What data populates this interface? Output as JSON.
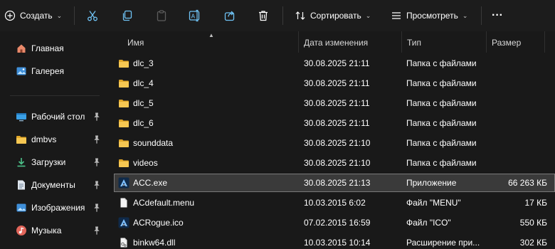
{
  "toolbar": {
    "create_label": "Создать",
    "sort_label": "Сортировать",
    "view_label": "Просмотреть",
    "more_label": "···"
  },
  "nav": {
    "items": [
      {
        "label": "Главная",
        "icon": "home-icon"
      },
      {
        "label": "Галерея",
        "icon": "gallery-icon"
      },
      {
        "label": "Рабочий стол",
        "icon": "desktop-icon"
      },
      {
        "label": "dmbvs",
        "icon": "folder-icon"
      },
      {
        "label": "Загрузки",
        "icon": "download-icon"
      },
      {
        "label": "Документы",
        "icon": "documents-icon"
      },
      {
        "label": "Изображения",
        "icon": "pictures-icon"
      },
      {
        "label": "Музыка",
        "icon": "music-icon"
      }
    ]
  },
  "columns": {
    "name": "Имя",
    "date": "Дата изменения",
    "type": "Тип",
    "size": "Размер"
  },
  "files": [
    {
      "name": "dlc_3",
      "date": "30.08.2025 21:11",
      "type": "Папка с файлами",
      "size": "",
      "icon": "folder-icon"
    },
    {
      "name": "dlc_4",
      "date": "30.08.2025 21:11",
      "type": "Папка с файлами",
      "size": "",
      "icon": "folder-icon"
    },
    {
      "name": "dlc_5",
      "date": "30.08.2025 21:11",
      "type": "Папка с файлами",
      "size": "",
      "icon": "folder-icon"
    },
    {
      "name": "dlc_6",
      "date": "30.08.2025 21:11",
      "type": "Папка с файлами",
      "size": "",
      "icon": "folder-icon"
    },
    {
      "name": "sounddata",
      "date": "30.08.2025 21:10",
      "type": "Папка с файлами",
      "size": "",
      "icon": "folder-icon"
    },
    {
      "name": "videos",
      "date": "30.08.2025 21:10",
      "type": "Папка с файлами",
      "size": "",
      "icon": "folder-icon"
    },
    {
      "name": "ACC.exe",
      "date": "30.08.2025 21:13",
      "type": "Приложение",
      "size": "66 263 КБ",
      "icon": "app-logo-icon",
      "selected": true
    },
    {
      "name": "ACdefault.menu",
      "date": "10.03.2015 6:02",
      "type": "Файл \"MENU\"",
      "size": "17 КБ",
      "icon": "file-icon"
    },
    {
      "name": "ACRogue.ico",
      "date": "07.02.2015 16:59",
      "type": "Файл \"ICO\"",
      "size": "550 КБ",
      "icon": "app-logo-icon"
    },
    {
      "name": "binkw64.dll",
      "date": "10.03.2015 10:14",
      "type": "Расширение при...",
      "size": "302 КБ",
      "icon": "dll-file-icon"
    }
  ],
  "colors": {
    "background": "#191919",
    "folder": "#f0c24b",
    "accent": "#60cdff"
  }
}
